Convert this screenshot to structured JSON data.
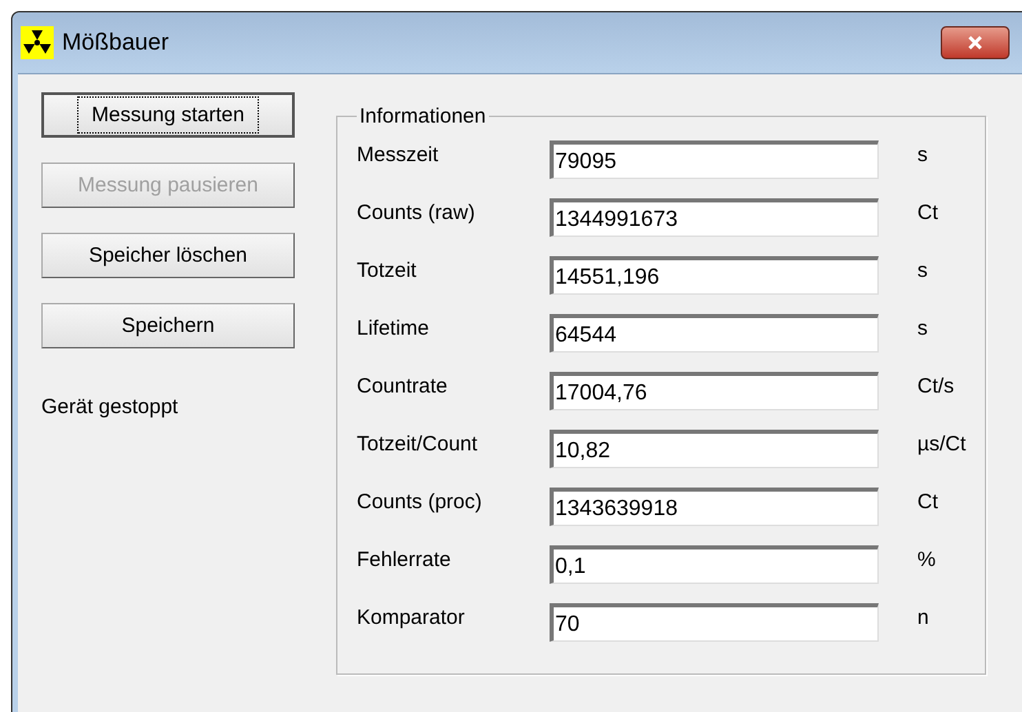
{
  "window": {
    "title": "Mößbauer"
  },
  "buttons": [
    {
      "label": "Messung starten",
      "focused": true,
      "disabled": false
    },
    {
      "label": "Messung pausieren",
      "focused": false,
      "disabled": true
    },
    {
      "label": "Speicher löschen",
      "focused": false,
      "disabled": false
    },
    {
      "label": "Speichern",
      "focused": false,
      "disabled": false
    }
  ],
  "status": "Gerät gestoppt",
  "group": {
    "title": "Informationen",
    "rows": [
      {
        "label": "Messzeit",
        "value": "79095",
        "unit": "s"
      },
      {
        "label": "Counts (raw)",
        "value": "1344991673",
        "unit": "Ct"
      },
      {
        "label": "Totzeit",
        "value": "14551,196",
        "unit": "s"
      },
      {
        "label": "Lifetime",
        "value": "64544",
        "unit": "s"
      },
      {
        "label": "Countrate",
        "value": "17004,76",
        "unit": "Ct/s"
      },
      {
        "label": "Totzeit/Count",
        "value": "10,82",
        "unit": "µs/Ct"
      },
      {
        "label": "Counts (proc)",
        "value": "1343639918",
        "unit": "Ct"
      },
      {
        "label": "Fehlerrate",
        "value": "0,1",
        "unit": "%"
      },
      {
        "label": "Komparator",
        "value": "70",
        "unit": "n"
      }
    ]
  }
}
